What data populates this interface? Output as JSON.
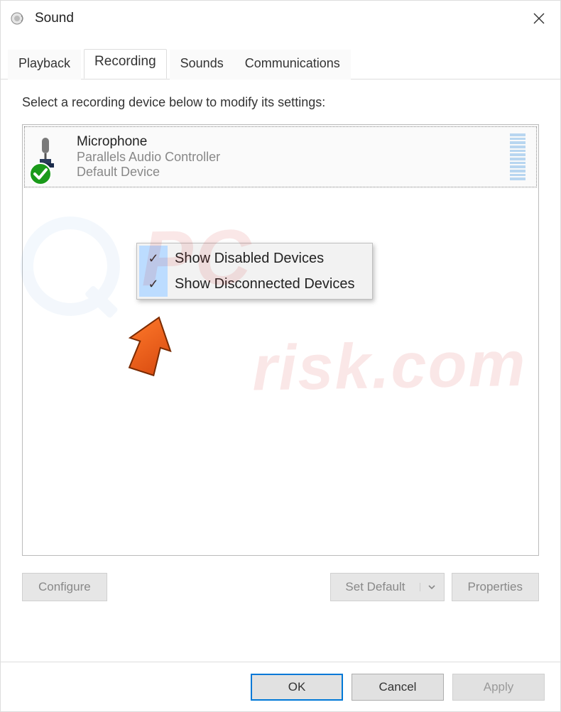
{
  "window": {
    "title": "Sound"
  },
  "tabs": [
    {
      "label": "Playback",
      "active": false
    },
    {
      "label": "Recording",
      "active": true
    },
    {
      "label": "Sounds",
      "active": false
    },
    {
      "label": "Communications",
      "active": false
    }
  ],
  "panel": {
    "instruction": "Select a recording device below to modify its settings:",
    "devices": [
      {
        "name": "Microphone",
        "driver": "Parallels Audio Controller",
        "status": "Default Device",
        "is_default": true
      }
    ]
  },
  "context_menu": {
    "items": [
      {
        "label": "Show Disabled Devices",
        "checked": true
      },
      {
        "label": "Show Disconnected Devices",
        "checked": true
      }
    ]
  },
  "toolbar": {
    "configure": "Configure",
    "set_default": "Set Default",
    "properties": "Properties"
  },
  "footer": {
    "ok": "OK",
    "cancel": "Cancel",
    "apply": "Apply"
  }
}
